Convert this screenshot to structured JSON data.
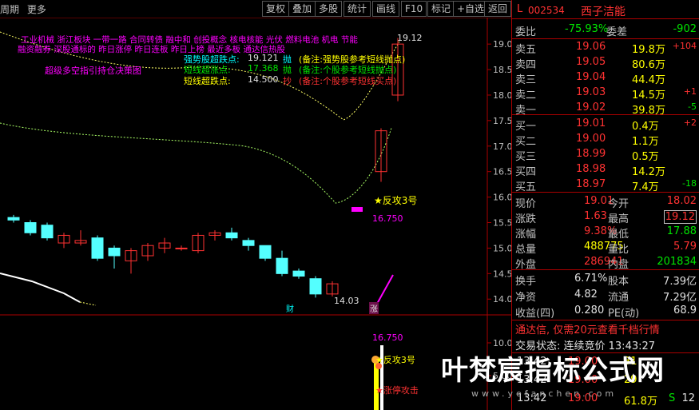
{
  "toolbar": {
    "left_labels": [
      "周期",
      "更多"
    ],
    "buttons": [
      "复权",
      "叠加",
      "多股",
      "统计",
      "画线",
      "F10",
      "标记",
      "+自选",
      "返回"
    ],
    "diamond": "◇"
  },
  "chart": {
    "concept_line1": "工业机械 浙江板块 一带一路 合同转债 融中和 创投概念 核电核能 光伏 燃料电池 机电 节能",
    "concept_line2": "融资融券 深股通标的 昨日涨停 昨日连板 昨日上榜 最近多板 通达信热股",
    "label_magenta": "超级多空指引持仓决策图",
    "indicators": [
      {
        "name": "强势股超跌点:",
        "value": "19.121",
        "tag": "抛",
        "note": "(备注:强势股参考短线抛点)"
      },
      {
        "name": "短线超涨点:",
        "value": "17.368",
        "tag": "抛",
        "note": "(备注:个股参考短线抛点)"
      },
      {
        "name": "短线超跌点:",
        "value": "14.500",
        "tag": "抄",
        "note": "(备注:个股参考短线买点)"
      }
    ],
    "high_marker": "19.12",
    "low_marker": "14.03",
    "buy_label": "★反攻3号",
    "small_value": "16.750",
    "cai": "财",
    "zhang": "涨",
    "lower_value": "16.750",
    "lower_buy": "★反攻3号",
    "lower_note": "★涨停攻击",
    "axis_ticks": [
      "19.00",
      "18.50",
      "18.00",
      "17.50",
      "17.00",
      "16.50",
      "16.00",
      "15.50",
      "15.00",
      "14.50",
      "14.00",
      "10.00",
      "5.00"
    ]
  },
  "chart_data": {
    "type": "candlestick",
    "title": "",
    "ylim": [
      13.8,
      19.3
    ],
    "candles": [
      {
        "o": 15.6,
        "c": 15.55,
        "h": 15.65,
        "l": 15.5
      },
      {
        "o": 15.5,
        "c": 15.3,
        "h": 15.55,
        "l": 15.25
      },
      {
        "o": 15.45,
        "c": 15.2,
        "h": 15.5,
        "l": 15.15
      },
      {
        "o": 15.1,
        "c": 15.25,
        "h": 15.3,
        "l": 15.0
      },
      {
        "o": 15.1,
        "c": 15.15,
        "h": 15.35,
        "l": 15.05
      },
      {
        "o": 15.2,
        "c": 14.8,
        "h": 15.25,
        "l": 14.75
      },
      {
        "o": 15.0,
        "c": 14.85,
        "h": 15.05,
        "l": 14.6
      },
      {
        "o": 14.75,
        "c": 14.95,
        "h": 15.0,
        "l": 14.5
      },
      {
        "o": 14.85,
        "c": 15.05,
        "h": 15.1,
        "l": 14.75
      },
      {
        "o": 15.0,
        "c": 15.1,
        "h": 15.2,
        "l": 14.9
      },
      {
        "o": 15.0,
        "c": 15.0,
        "h": 15.05,
        "l": 14.95
      },
      {
        "o": 14.95,
        "c": 15.25,
        "h": 15.3,
        "l": 14.9
      },
      {
        "o": 15.25,
        "c": 15.3,
        "h": 15.35,
        "l": 15.15
      },
      {
        "o": 15.3,
        "c": 15.2,
        "h": 15.4,
        "l": 15.15
      },
      {
        "o": 15.15,
        "c": 15.05,
        "h": 15.2,
        "l": 14.95
      },
      {
        "o": 15.05,
        "c": 14.8,
        "h": 15.05,
        "l": 14.75
      },
      {
        "o": 14.8,
        "c": 14.5,
        "h": 14.95,
        "l": 14.45
      },
      {
        "o": 14.55,
        "c": 14.45,
        "h": 14.6,
        "l": 14.4
      },
      {
        "o": 14.4,
        "c": 14.1,
        "h": 14.45,
        "l": 14.03
      },
      {
        "o": 14.1,
        "c": 14.3,
        "h": 14.35,
        "l": 14.05
      },
      {
        "o": 16.5,
        "c": 17.3,
        "h": 17.35,
        "l": 16.3
      },
      {
        "o": 18.0,
        "c": 19.0,
        "h": 19.12,
        "l": 17.88
      }
    ]
  },
  "panel": {
    "code": "002534",
    "name": "西子洁能",
    "tag": "L",
    "weibi_label": "委比",
    "weibi": "-75.93%",
    "weicha_label": "委差",
    "weicha": "-902",
    "asks": [
      {
        "label": "卖五",
        "price": "19.06",
        "vol": "19.8万",
        "chg": "+104"
      },
      {
        "label": "卖四",
        "price": "19.05",
        "vol": "80.6万",
        "chg": ""
      },
      {
        "label": "卖三",
        "price": "19.04",
        "vol": "44.4万",
        "chg": ""
      },
      {
        "label": "卖二",
        "price": "19.03",
        "vol": "14.5万",
        "chg": "+1"
      },
      {
        "label": "卖一",
        "price": "19.02",
        "vol": "39.8万",
        "chg": "-5"
      }
    ],
    "bids": [
      {
        "label": "买一",
        "price": "19.01",
        "vol": "0.4万",
        "chg": "+2"
      },
      {
        "label": "买二",
        "price": "19.00",
        "vol": "1.1万",
        "chg": ""
      },
      {
        "label": "买三",
        "price": "18.99",
        "vol": "0.5万",
        "chg": ""
      },
      {
        "label": "买四",
        "price": "18.98",
        "vol": "14.2万",
        "chg": ""
      },
      {
        "label": "买五",
        "price": "18.97",
        "vol": "7.4万",
        "chg": "-18"
      }
    ],
    "stats": [
      {
        "l1": "现价",
        "v1": "19.01",
        "l2": "今开",
        "v2": "18.02"
      },
      {
        "l1": "涨跌",
        "v1": "1.63",
        "l2": "最高",
        "v2": "19.12"
      },
      {
        "l1": "涨幅",
        "v1": "9.38%",
        "l2": "最低",
        "v2": "17.88"
      },
      {
        "l1": "总量",
        "v1": "488775",
        "l2": "量比",
        "v2": "5.79"
      },
      {
        "l1": "外盘",
        "v1": "286941",
        "l2": "内盘",
        "v2": "201834"
      }
    ],
    "stats2": [
      {
        "l1": "换手",
        "v1": "6.71%",
        "l2": "股本",
        "v2": "7.39亿"
      },
      {
        "l1": "净资",
        "v1": "4.82",
        "l2": "流通",
        "v2": "7.29亿"
      },
      {
        "l1": "收益(四)",
        "v1": "0.280",
        "l2": "PE(动)",
        "v2": "68.9"
      }
    ],
    "promo": "通达信, 仅需20元查看千档行情",
    "status": "交易状态: 连续竞价 13:43:27",
    "ticks": [
      {
        "time": "13:42",
        "price": "19.00",
        "vol": "31",
        "bs": ""
      },
      {
        "time": "13:42",
        "price": "19.00",
        "vol": "29",
        "bs": ""
      },
      {
        "time": "13:42",
        "price": "19.00",
        "vol": "61.8万",
        "bs": "S",
        "num": "12"
      }
    ]
  },
  "watermark": {
    "text": "叶梵宸指标公式网",
    "url": "www.yefanchen.com"
  }
}
